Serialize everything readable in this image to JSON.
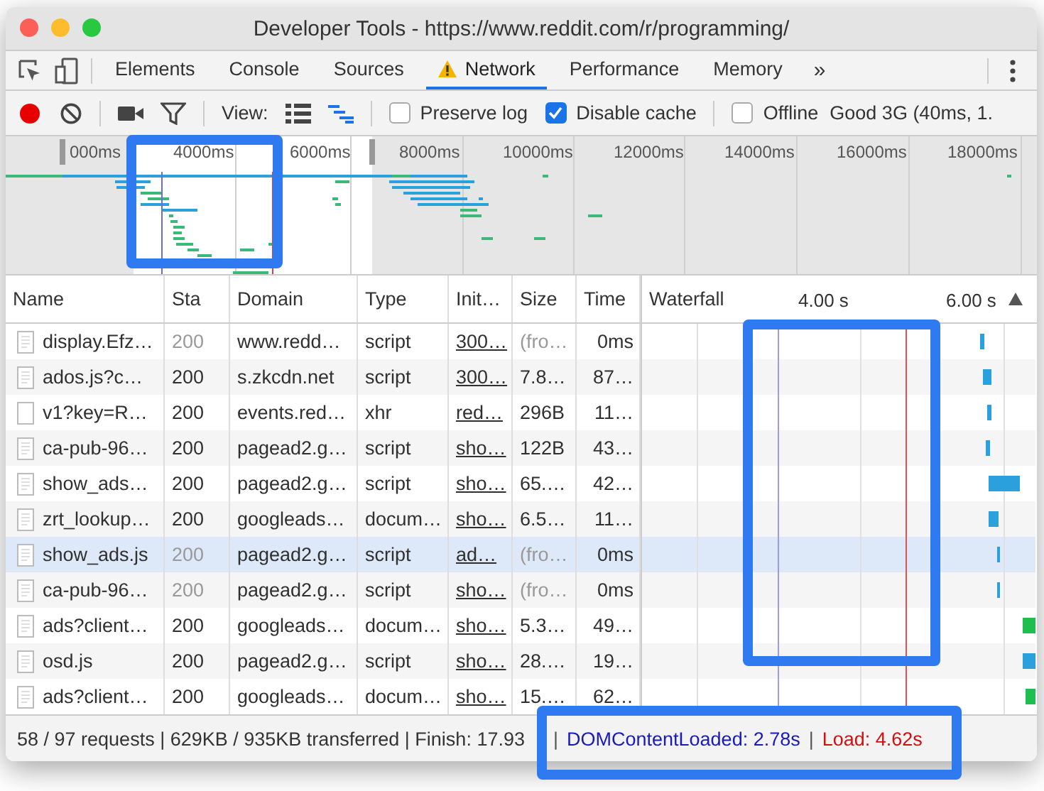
{
  "window": {
    "title": "Developer Tools - https://www.reddit.com/r/programming/"
  },
  "tabs": [
    {
      "label": "Elements",
      "selected": false,
      "warning": false
    },
    {
      "label": "Console",
      "selected": false,
      "warning": false
    },
    {
      "label": "Sources",
      "selected": false,
      "warning": false
    },
    {
      "label": "Network",
      "selected": true,
      "warning": true
    },
    {
      "label": "Performance",
      "selected": false,
      "warning": false
    },
    {
      "label": "Memory",
      "selected": false,
      "warning": false
    }
  ],
  "more_tabs": "»",
  "toolbar": {
    "recording": true,
    "view_label": "View:",
    "large_rows": false,
    "waterfall_view": true,
    "checkboxes": [
      {
        "label": "Preserve log",
        "checked": false
      },
      {
        "label": "Disable cache",
        "checked": true
      },
      {
        "label": "Offline",
        "checked": false
      }
    ],
    "throttling": "Good 3G (40ms, 1."
  },
  "overview": {
    "ticks": [
      "000ms",
      "4000ms",
      "6000ms",
      "8000ms",
      "10000ms",
      "12000ms",
      "14000ms",
      "16000ms",
      "18000ms"
    ]
  },
  "table": {
    "columns": [
      "Name",
      "Sta",
      "Domain",
      "Type",
      "Init…",
      "Size",
      "Time",
      "Waterfall"
    ],
    "waterfall_ticks": [
      "4.00 s",
      "6.00 s"
    ],
    "rows": [
      {
        "name": "display.Efz…",
        "status": "200",
        "domain": "www.redd…",
        "type": "script",
        "initiator": "300…",
        "size": "(fro…",
        "time": "0ms",
        "cached": true,
        "selected": false,
        "kind": "script"
      },
      {
        "name": "ados.js?c…",
        "status": "200",
        "domain": "s.zkcdn.net",
        "type": "script",
        "initiator": "300…",
        "size": "7.8…",
        "time": "87…",
        "cached": false,
        "selected": false,
        "kind": "script"
      },
      {
        "name": "v1?key=R…",
        "status": "200",
        "domain": "events.red…",
        "type": "xhr",
        "initiator": "red…",
        "size": "296B",
        "time": "11…",
        "cached": false,
        "selected": false,
        "kind": "xhr"
      },
      {
        "name": "ca-pub-96…",
        "status": "200",
        "domain": "pagead2.g…",
        "type": "script",
        "initiator": "sho…",
        "size": "122B",
        "time": "43…",
        "cached": false,
        "selected": false,
        "kind": "script"
      },
      {
        "name": "show_ads…",
        "status": "200",
        "domain": "pagead2.g…",
        "type": "script",
        "initiator": "sho…",
        "size": "65.…",
        "time": "42…",
        "cached": false,
        "selected": false,
        "kind": "script"
      },
      {
        "name": "zrt_lookup…",
        "status": "200",
        "domain": "googleads…",
        "type": "docum…",
        "initiator": "sho…",
        "size": "6.5…",
        "time": "11…",
        "cached": false,
        "selected": false,
        "kind": "script"
      },
      {
        "name": "show_ads.js",
        "status": "200",
        "domain": "pagead2.g…",
        "type": "script",
        "initiator": "ad…",
        "size": "(fro…",
        "time": "0ms",
        "cached": true,
        "selected": true,
        "kind": "script"
      },
      {
        "name": "ca-pub-96…",
        "status": "200",
        "domain": "pagead2.g…",
        "type": "script",
        "initiator": "sho…",
        "size": "(fro…",
        "time": "0ms",
        "cached": true,
        "selected": false,
        "kind": "script"
      },
      {
        "name": "ads?client…",
        "status": "200",
        "domain": "googleads…",
        "type": "docum…",
        "initiator": "sho…",
        "size": "5.3…",
        "time": "49…",
        "cached": false,
        "selected": false,
        "kind": "script"
      },
      {
        "name": "osd.js",
        "status": "200",
        "domain": "pagead2.g…",
        "type": "script",
        "initiator": "sho…",
        "size": "28.…",
        "time": "19…",
        "cached": false,
        "selected": false,
        "kind": "script"
      },
      {
        "name": "ads?client…",
        "status": "200",
        "domain": "googleads…",
        "type": "docum…",
        "initiator": "sho…",
        "size": "15.…",
        "time": "62…",
        "cached": false,
        "selected": false,
        "kind": "script"
      }
    ]
  },
  "status_bar": {
    "summary": "58 / 97 requests | 629KB / 935KB transferred | Finish: 17.93",
    "separator": "|",
    "dom_content_loaded": "DOMContentLoaded: 2.78s",
    "separator_2": "|",
    "load": "Load: 4.62s"
  }
}
